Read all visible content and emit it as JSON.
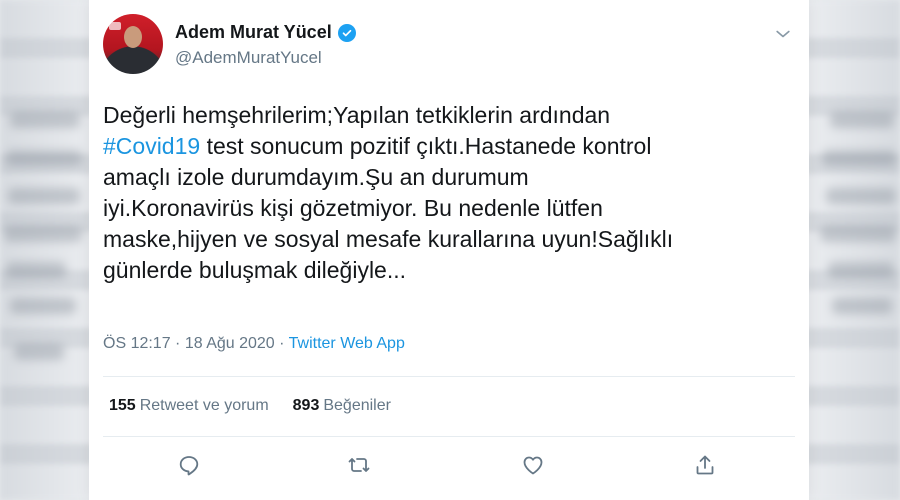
{
  "author": {
    "display_name": "Adem Murat Yücel",
    "handle": "@AdemMuratYucel",
    "verified_icon": "verified-badge-icon",
    "avatar": "profile-avatar"
  },
  "tweet": {
    "text_before": "Değerli hemşehrilerim;Yapılan tetkiklerin ardından\n",
    "hashtag": "#Covid19",
    "text_after": " test sonucum pozitif çıktı.Hastanede kontrol\namaçlı izole durumdayım.Şu an durumum\niyi.Koronavirüs kişi gözetmiyor. Bu nedenle lütfen\nmaske,hijyen ve sosyal mesafe kurallarına uyun!Sağlıklı\ngünlerde buluşmak dileğiyle..."
  },
  "meta": {
    "time": "ÖS 12:17",
    "separator1": " · ",
    "date": "18 Ağu 2020",
    "separator2": " · ",
    "source": "Twitter Web App"
  },
  "stats": {
    "retweets_count": "155",
    "retweets_label": "Retweet ve yorum",
    "likes_count": "893",
    "likes_label": "Beğeniler"
  },
  "actions": {
    "reply_icon": "reply-icon",
    "retweet_icon": "retweet-icon",
    "like_icon": "heart-icon",
    "share_icon": "share-icon"
  },
  "colors": {
    "accent": "#1da1f2",
    "link": "#1b95e0",
    "text": "#14171a",
    "secondary": "#657786"
  }
}
